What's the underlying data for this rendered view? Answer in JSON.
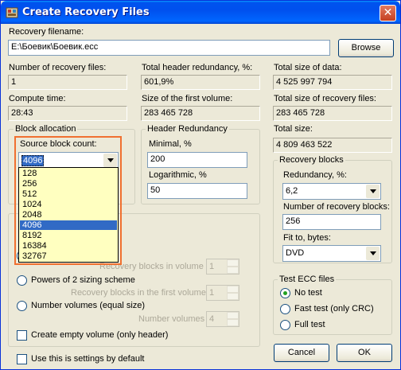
{
  "window": {
    "title": "Create Recovery Files"
  },
  "recovery_filename": {
    "label": "Recovery filename:",
    "value": "E:\\Боевик\\Боевик.ecc",
    "browse_label": "Browse"
  },
  "stats": {
    "num_files_label": "Number of recovery files:",
    "num_files": "1",
    "header_redundancy_label": "Total header redundancy, %:",
    "header_redundancy": "601,9%",
    "total_data_label": "Total size of data:",
    "total_data": "4 525 997 794",
    "compute_time_label": "Compute time:",
    "compute_time": "28:43",
    "first_volume_label": "Size of the first volume:",
    "first_volume": "283 465 728",
    "total_recovery_label": "Total size of recovery files:",
    "total_recovery": "283 465 728",
    "total_size_label": "Total size:",
    "total_size": "4 809 463 522"
  },
  "block_allocation": {
    "title": "Block allocation",
    "source_label": "Source block count:",
    "selected": "4096",
    "options": [
      "128",
      "256",
      "512",
      "1024",
      "2048",
      "4096",
      "8192",
      "16384",
      "32767"
    ]
  },
  "header_redundancy": {
    "title": "Header Redundancy",
    "minimal_label": "Minimal, %",
    "minimal": "200",
    "log_label": "Logarithmic, %",
    "log": "50"
  },
  "recovery_blocks": {
    "title": "Recovery blocks",
    "redundancy_label": "Redundancy, %:",
    "redundancy": "6,2",
    "number_label": "Number of recovery blocks:",
    "number": "256",
    "fit_label": "Fit to, bytes:",
    "fit": "DVD"
  },
  "volumes": {
    "blocks_in_volume_label": "Recovery blocks in volume",
    "blocks_in_volume": "1",
    "pow2_label": "Powers of 2 sizing scheme",
    "blocks_first_label": "Recovery blocks in the first volume",
    "blocks_first": "1",
    "equal_label": "Number volumes (equal size)",
    "number_volumes_label": "Number volumes",
    "number_volumes": "4",
    "empty_label": "Create empty volume (only header)"
  },
  "test_ecc": {
    "title": "Test ECC files",
    "no_test": "No test",
    "fast_test": "Fast test (only CRC)",
    "full_test": "Full test"
  },
  "footer": {
    "default_label": "Use this is settings by default",
    "cancel_label": "Cancel",
    "ok_label": "OK"
  }
}
